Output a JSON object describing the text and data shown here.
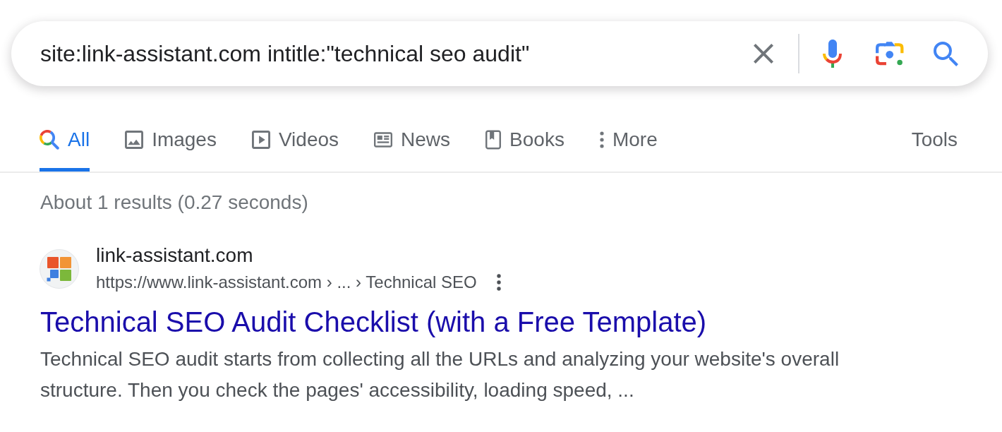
{
  "search": {
    "value": "site:link-assistant.com intitle:\"technical seo audit\""
  },
  "tabs": [
    {
      "kind": "all",
      "label": "All",
      "selected": true
    },
    {
      "kind": "images",
      "label": "Images",
      "selected": false
    },
    {
      "kind": "videos",
      "label": "Videos",
      "selected": false
    },
    {
      "kind": "news",
      "label": "News",
      "selected": false
    },
    {
      "kind": "books",
      "label": "Books",
      "selected": false
    },
    {
      "kind": "more",
      "label": "More",
      "selected": false
    }
  ],
  "tools": {
    "label": "Tools"
  },
  "result_stats": "About 1 results (0.27 seconds)",
  "results": [
    {
      "site_name": "link-assistant.com",
      "url": "https://www.link-assistant.com › ... › Technical SEO",
      "title": "Technical SEO Audit Checklist (with a Free Template)",
      "snippet": "Technical SEO audit starts from collecting all the URLs and analyzing your website's overall structure. Then you check the pages' accessibility, loading speed, ..."
    }
  ]
}
